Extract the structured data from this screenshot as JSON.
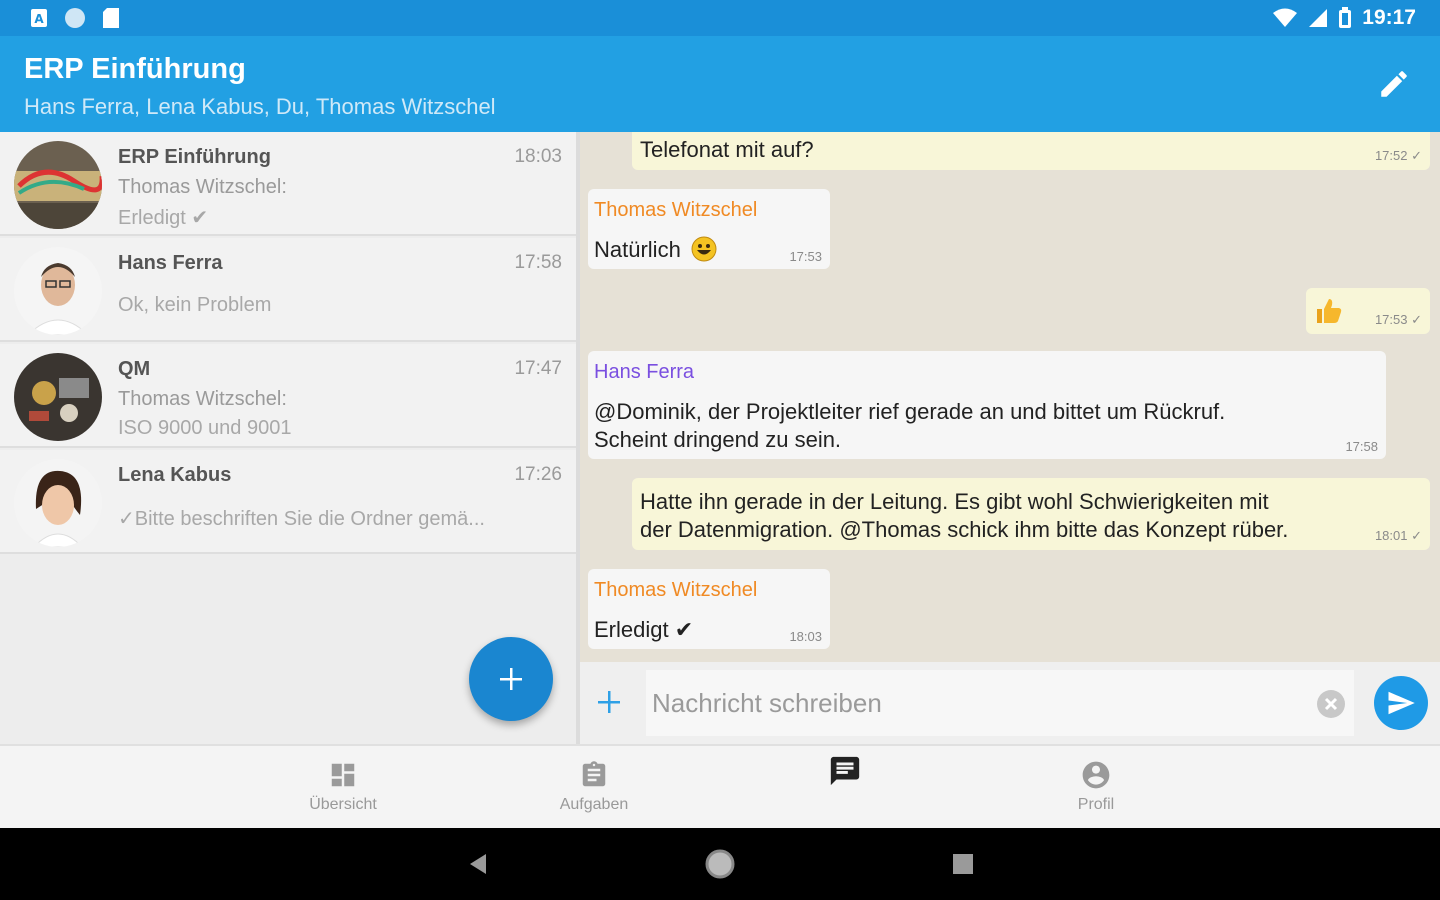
{
  "status_bar": {
    "time": "19:17"
  },
  "app_bar": {
    "title": "ERP Einführung",
    "subtitle": "Hans Ferra, Lena Kabus, Du, Thomas Witzschel"
  },
  "chats": [
    {
      "name": "ERP Einführung",
      "time": "18:03",
      "line1": "Thomas Witzschel:",
      "line2": "Erledigt ✔"
    },
    {
      "name": "Hans Ferra",
      "time": "17:58",
      "preview": "Ok, kein Problem"
    },
    {
      "name": "QM",
      "time": "17:47",
      "line1": "Thomas Witzschel:",
      "line2": "ISO 9000 und 9001"
    },
    {
      "name": "Lena Kabus",
      "time": "17:26",
      "preview": "✓Bitte beschriften Sie die Ordner gemä..."
    }
  ],
  "messages": [
    {
      "text": "Telefonat mit auf?",
      "time": "17:52 ✓"
    },
    {
      "sender": "Thomas Witzschel",
      "text": "Natürlich",
      "time": "17:53"
    },
    {
      "time": "17:53 ✓"
    },
    {
      "sender": "Hans Ferra",
      "text1": "@Dominik, der Projektleiter rief gerade an und bittet um Rückruf.",
      "text2": "Scheint dringend zu sein.",
      "time": "17:58"
    },
    {
      "text1": "Hatte ihn gerade in der Leitung. Es gibt wohl Schwierigkeiten mit",
      "text2": "der Datenmigration. @Thomas schick ihm bitte das Konzept rüber.",
      "time": "18:01 ✓"
    },
    {
      "sender": "Thomas Witzschel",
      "text": "Erledigt ✔",
      "time": "18:03"
    }
  ],
  "composer": {
    "placeholder": "Nachricht schreiben"
  },
  "colors": {
    "primary": "#22a0e3",
    "status": "#1a8fd8",
    "sender_orange": "#f08a24",
    "sender_purple": "#7a4fe0",
    "out_bubble": "#f8f6d8"
  },
  "bottom_nav": [
    {
      "label": "Übersicht"
    },
    {
      "label": "Aufgaben"
    },
    {
      "label": ""
    },
    {
      "label": "Profil"
    }
  ]
}
